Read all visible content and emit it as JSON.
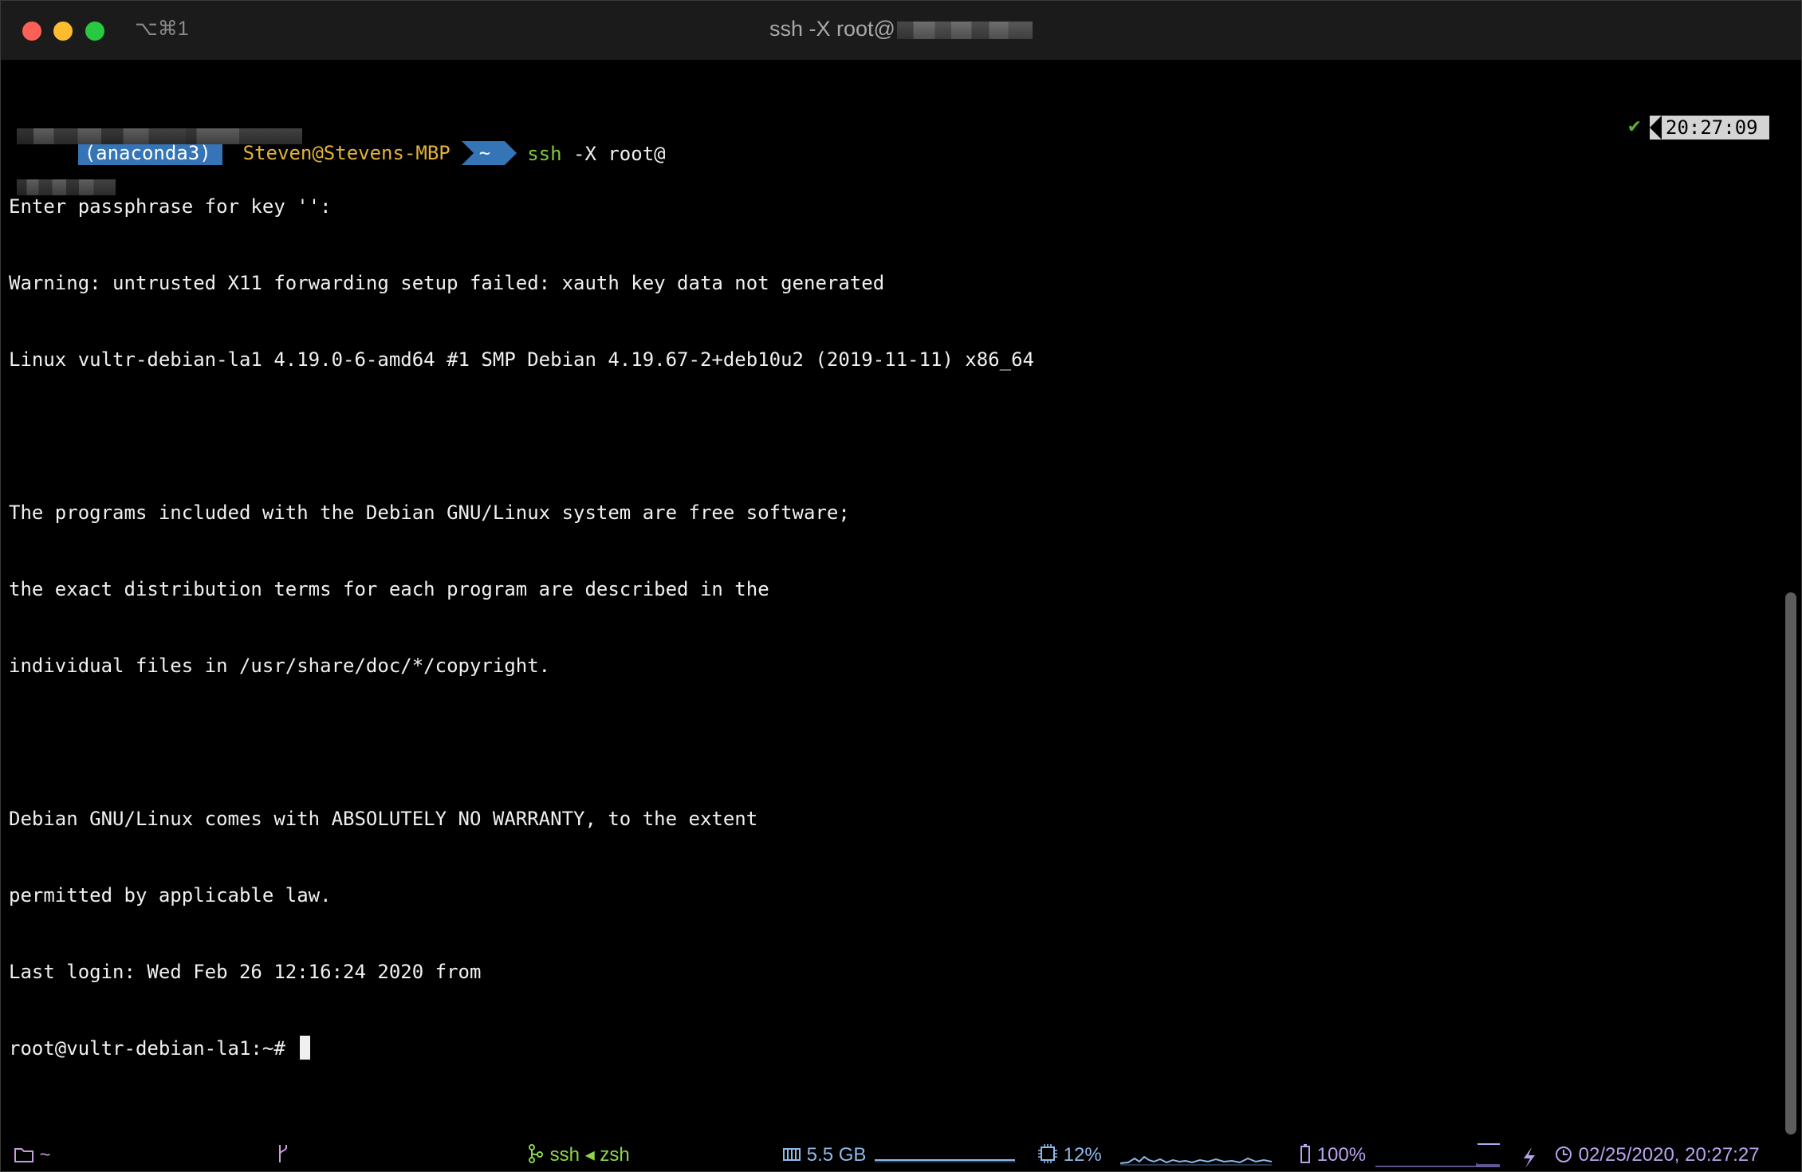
{
  "window": {
    "shortcut": "⌥⌘1",
    "title_prefix": "ssh -X root@"
  },
  "icons": {
    "close": "close-icon",
    "minimize": "minimize-icon",
    "zoom": "zoom-icon"
  },
  "prompt": {
    "env": "(anaconda3)",
    "user_host": "Steven@Stevens-MBP",
    "dir": "~",
    "cmd_name": "ssh",
    "cmd_args": " -X root@",
    "status_check": "✔",
    "time": "20:27:09"
  },
  "output": {
    "l1_prefix": "Enter passphrase for key '",
    "l1_suffix": "':",
    "l2": "Warning: untrusted X11 forwarding setup failed: xauth key data not generated",
    "l3": "Linux vultr-debian-la1 4.19.0-6-amd64 #1 SMP Debian 4.19.67-2+deb10u2 (2019-11-11) x86_64",
    "l5": "The programs included with the Debian GNU/Linux system are free software;",
    "l6": "the exact distribution terms for each program are described in the",
    "l7": "individual files in /usr/share/doc/*/copyright.",
    "l9": "Debian GNU/Linux comes with ABSOLUTELY NO WARRANTY, to the extent",
    "l10": "permitted by applicable law.",
    "l11_prefix": "Last login: Wed Feb 26 12:16:24 2020 from ",
    "remote_prompt": "root@vultr-debian-la1:~#"
  },
  "statusbar": {
    "dir": "~",
    "job": "ssh ◂ zsh",
    "memory": "5.5 GB",
    "cpu": "12%",
    "battery": "100%",
    "clock": "02/25/2020, 20:27:27"
  },
  "colors": {
    "prompt_blue": "#3574b6",
    "user_yellow": "#e2b23b",
    "cmd_green": "#7ccd3c",
    "status_purple": "#c89bd9",
    "status_blue": "#8fb9ea"
  }
}
